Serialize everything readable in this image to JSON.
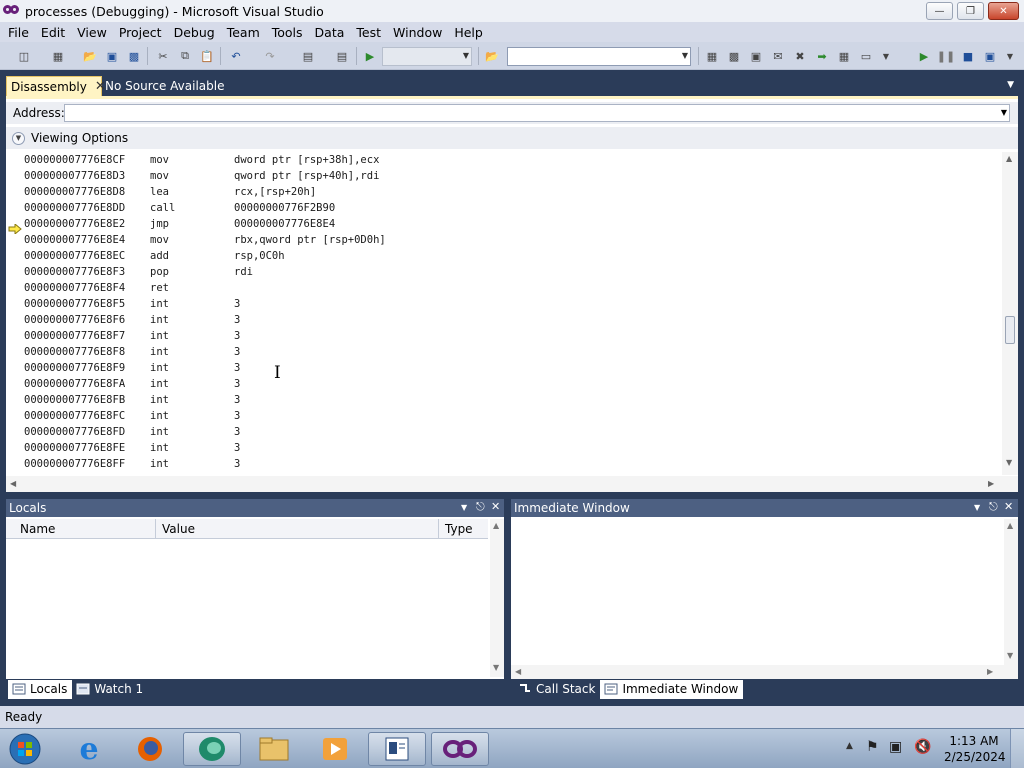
{
  "window": {
    "title": "processes (Debugging) - Microsoft Visual Studio",
    "controls": [
      "minimize-icon",
      "restore-icon",
      "close-icon"
    ]
  },
  "menu": [
    "File",
    "Edit",
    "View",
    "Project",
    "Debug",
    "Team",
    "Tools",
    "Data",
    "Test",
    "Window",
    "Help"
  ],
  "document_tabs": {
    "active": "Disassembly",
    "inactive": "No Source Available"
  },
  "address_bar": {
    "label": "Address:",
    "value": ""
  },
  "viewing_options": {
    "label": "Viewing Options"
  },
  "disassembly": [
    {
      "addr": "000000007776E8CF",
      "op": "mov",
      "arg": "dword ptr [rsp+38h],ecx"
    },
    {
      "addr": "000000007776E8D3",
      "op": "mov",
      "arg": "qword ptr [rsp+40h],rdi"
    },
    {
      "addr": "000000007776E8D8",
      "op": "lea",
      "arg": "rcx,[rsp+20h]"
    },
    {
      "addr": "000000007776E8DD",
      "op": "call",
      "arg": "00000000776F2B90"
    },
    {
      "addr": "000000007776E8E2",
      "op": "jmp",
      "arg": "000000007776E8E4",
      "current": true
    },
    {
      "addr": "000000007776E8E4",
      "op": "mov",
      "arg": "rbx,qword ptr [rsp+0D0h]"
    },
    {
      "addr": "000000007776E8EC",
      "op": "add",
      "arg": "rsp,0C0h"
    },
    {
      "addr": "000000007776E8F3",
      "op": "pop",
      "arg": "rdi"
    },
    {
      "addr": "000000007776E8F4",
      "op": "ret",
      "arg": ""
    },
    {
      "addr": "000000007776E8F5",
      "op": "int",
      "arg": "3"
    },
    {
      "addr": "000000007776E8F6",
      "op": "int",
      "arg": "3"
    },
    {
      "addr": "000000007776E8F7",
      "op": "int",
      "arg": "3"
    },
    {
      "addr": "000000007776E8F8",
      "op": "int",
      "arg": "3"
    },
    {
      "addr": "000000007776E8F9",
      "op": "int",
      "arg": "3"
    },
    {
      "addr": "000000007776E8FA",
      "op": "int",
      "arg": "3"
    },
    {
      "addr": "000000007776E8FB",
      "op": "int",
      "arg": "3"
    },
    {
      "addr": "000000007776E8FC",
      "op": "int",
      "arg": "3"
    },
    {
      "addr": "000000007776E8FD",
      "op": "int",
      "arg": "3"
    },
    {
      "addr": "000000007776E8FE",
      "op": "int",
      "arg": "3"
    },
    {
      "addr": "000000007776E8FF",
      "op": "int",
      "arg": "3"
    }
  ],
  "locals": {
    "title": "Locals",
    "columns": [
      "Name",
      "Value",
      "Type"
    ]
  },
  "immediate": {
    "title": "Immediate Window"
  },
  "left_bottom_tabs": [
    "Locals",
    "Watch 1"
  ],
  "right_bottom_tabs": [
    "Call Stack",
    "Immediate Window"
  ],
  "status": "Ready",
  "taskbar": {
    "apps": [
      "start-orb-icon",
      "internet-explorer-icon",
      "firefox-icon",
      "media-app-icon",
      "file-explorer-icon",
      "media-player-icon",
      "document-app-icon",
      "visual-studio-icon"
    ],
    "time": "1:13 AM",
    "date": "2/25/2024"
  },
  "colors": {
    "accent_tab": "#fff4c4",
    "chrome_dark": "#2b3c59",
    "toolwindow_header": "#4d6082"
  }
}
